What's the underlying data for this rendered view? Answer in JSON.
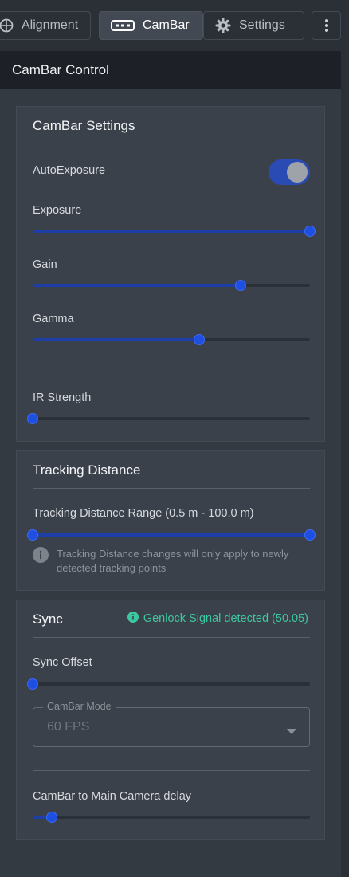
{
  "tabs": {
    "alignment": "Alignment",
    "cambar": "CamBar",
    "settings": "Settings"
  },
  "panel": {
    "title": "CamBar Control"
  },
  "cambar_settings": {
    "title": "CamBar Settings",
    "auto_exposure_label": "AutoExposure",
    "auto_exposure_on": true,
    "exposure_label": "Exposure",
    "exposure_value": 1.0,
    "gain_label": "Gain",
    "gain_value": 0.75,
    "gamma_label": "Gamma",
    "gamma_value": 0.6,
    "ir_strength_label": "IR Strength",
    "ir_strength_value": 0.0
  },
  "tracking": {
    "title": "Tracking Distance",
    "range_label": "Tracking Distance Range (0.5 m - 100.0 m)",
    "range_low": 0.0,
    "range_high": 1.0,
    "note": "Tracking Distance changes will only apply to newly detected tracking points"
  },
  "sync": {
    "title": "Sync",
    "genlock_status": "Genlock Signal detected (50.05)",
    "offset_label": "Sync Offset",
    "offset_value": 0.0,
    "mode_legend": "CamBar Mode",
    "mode_value": "60 FPS",
    "delay_label": "CamBar to Main Camera delay",
    "delay_value": 0.07
  },
  "colors": {
    "accent": "#1f4fe0",
    "status_ok": "#3cc7a0"
  }
}
